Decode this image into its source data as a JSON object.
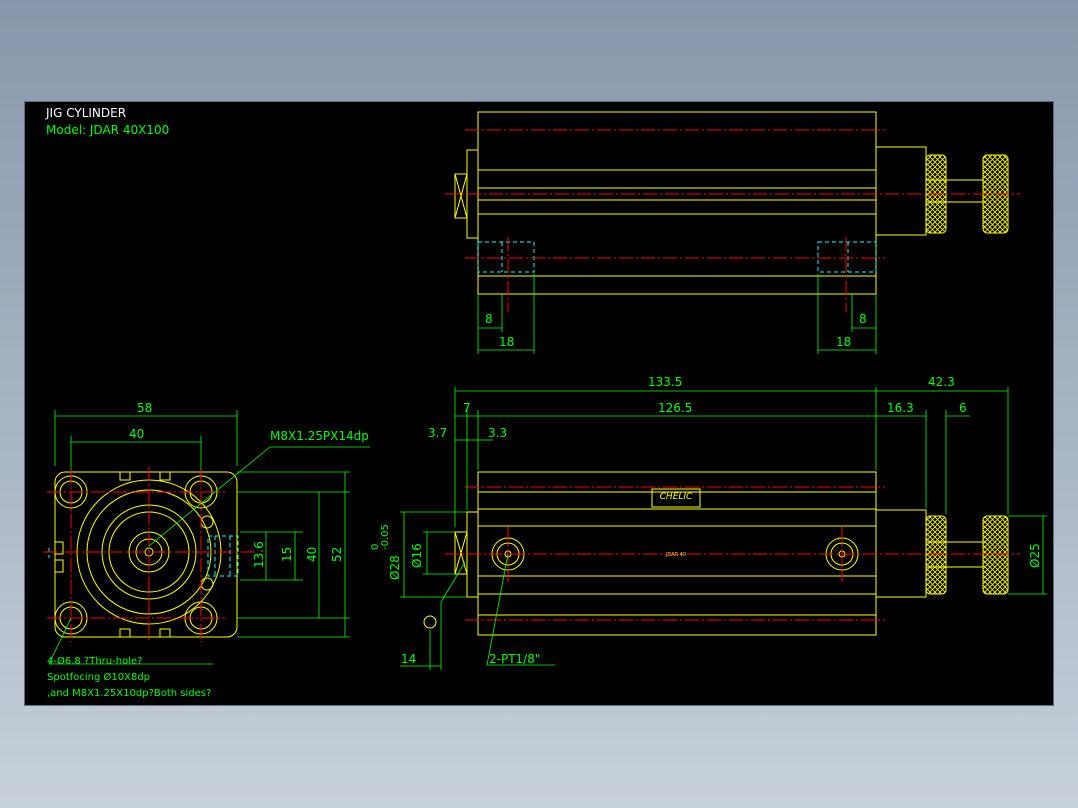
{
  "title": "JIG CYLINDER",
  "model": "Model:  JDAR 40X100",
  "colors": {
    "background": "#000000",
    "outline": "#ffff00",
    "dimension": "#00ff00",
    "centerline": "#ff0000",
    "hidden": "#00ffff"
  },
  "front_view": {
    "dims": {
      "width_58": "58",
      "pitch_40": "40",
      "thread_callout": "M8X1.25PX14dp",
      "port_13_6": "13.6",
      "port_15": "15",
      "height_40": "40",
      "height_52": "52"
    },
    "hole_note": {
      "line1": "4-Ø6.8  ?Thru-hole?",
      "line2": "Spotfocing  Ø10X8dp",
      "line3": ",and M8X1.25X10dp?Both sides?"
    }
  },
  "top_view": {
    "dims": {
      "left_8": "8",
      "left_18": "18",
      "right_8": "8",
      "right_18": "18"
    }
  },
  "side_view": {
    "dims": {
      "overall_133_5": "133.5",
      "rod_42_3": "42.3",
      "offset_7": "7",
      "body_126_5": "126.5",
      "rod_16_3": "16.3",
      "rod_6": "6",
      "flange_3_7": "3.7",
      "flange_3_3": "3.3",
      "dia_28": "Ø28",
      "dia_28_tol_upper": "0",
      "dia_28_tol_lower": "-0.05",
      "dia_16": "Ø16",
      "dia_25": "Ø25",
      "dim_14": "14",
      "port_callout": "2-PT1/8\""
    },
    "label_brand": "CHELIC",
    "label_model": "JDAR 40"
  }
}
